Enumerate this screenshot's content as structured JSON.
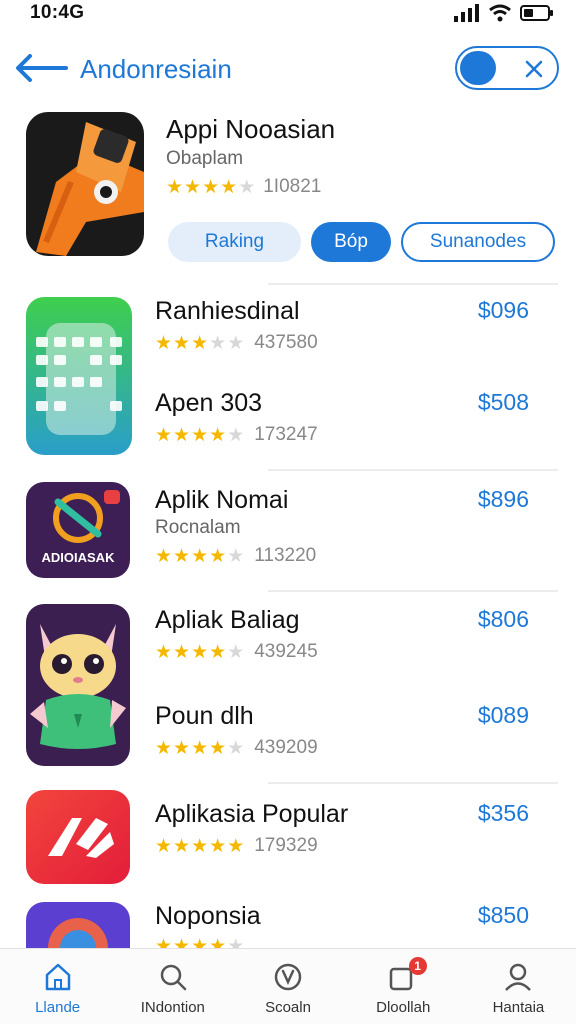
{
  "status": {
    "time": "10:4G"
  },
  "nav": {
    "title": "Andonresiain"
  },
  "featured": {
    "title": "Appi Nooasian",
    "subtitle": "Obaplam",
    "stars": 4,
    "rating_count": "1I0821",
    "chips": [
      "Raking",
      "Bóp",
      "Sunanodes"
    ]
  },
  "apps": [
    {
      "title": "Ranhiesdinal",
      "stars": 3,
      "rating_count": "437580",
      "price": "$096"
    },
    {
      "title": "Apen 303",
      "stars": 4,
      "rating_count": "173247",
      "price": "$508"
    },
    {
      "title": "Aplik Nomai",
      "subtitle": "Rocnalam",
      "stars": 4,
      "rating_count": "113220",
      "price": "$896",
      "icon_text": "ADIOIASAK"
    },
    {
      "title": "Apliak Baliag",
      "stars": 4,
      "rating_count": "439245",
      "price": "$806"
    },
    {
      "title": "Poun dlh",
      "stars": 4,
      "rating_count": "439209",
      "price": "$089"
    },
    {
      "title": "Aplikasia Popular",
      "stars": 5,
      "rating_count": "179329",
      "price": "$356"
    },
    {
      "title": "Noponsia",
      "stars": 4,
      "rating_count": "",
      "price": "$850"
    }
  ],
  "tabs": [
    {
      "label": "Llande",
      "icon": "home-icon",
      "active": true
    },
    {
      "label": "INdontion",
      "icon": "search-icon",
      "active": false
    },
    {
      "label": "Scoaln",
      "icon": "discover-icon",
      "active": false
    },
    {
      "label": "Dloollah",
      "icon": "updates-icon",
      "active": false,
      "badge": "1"
    },
    {
      "label": "Hantaia",
      "icon": "profile-icon",
      "active": false
    }
  ],
  "colors": {
    "accent": "#1e78d7",
    "star": "#f5b800",
    "divider": "#ececec"
  }
}
